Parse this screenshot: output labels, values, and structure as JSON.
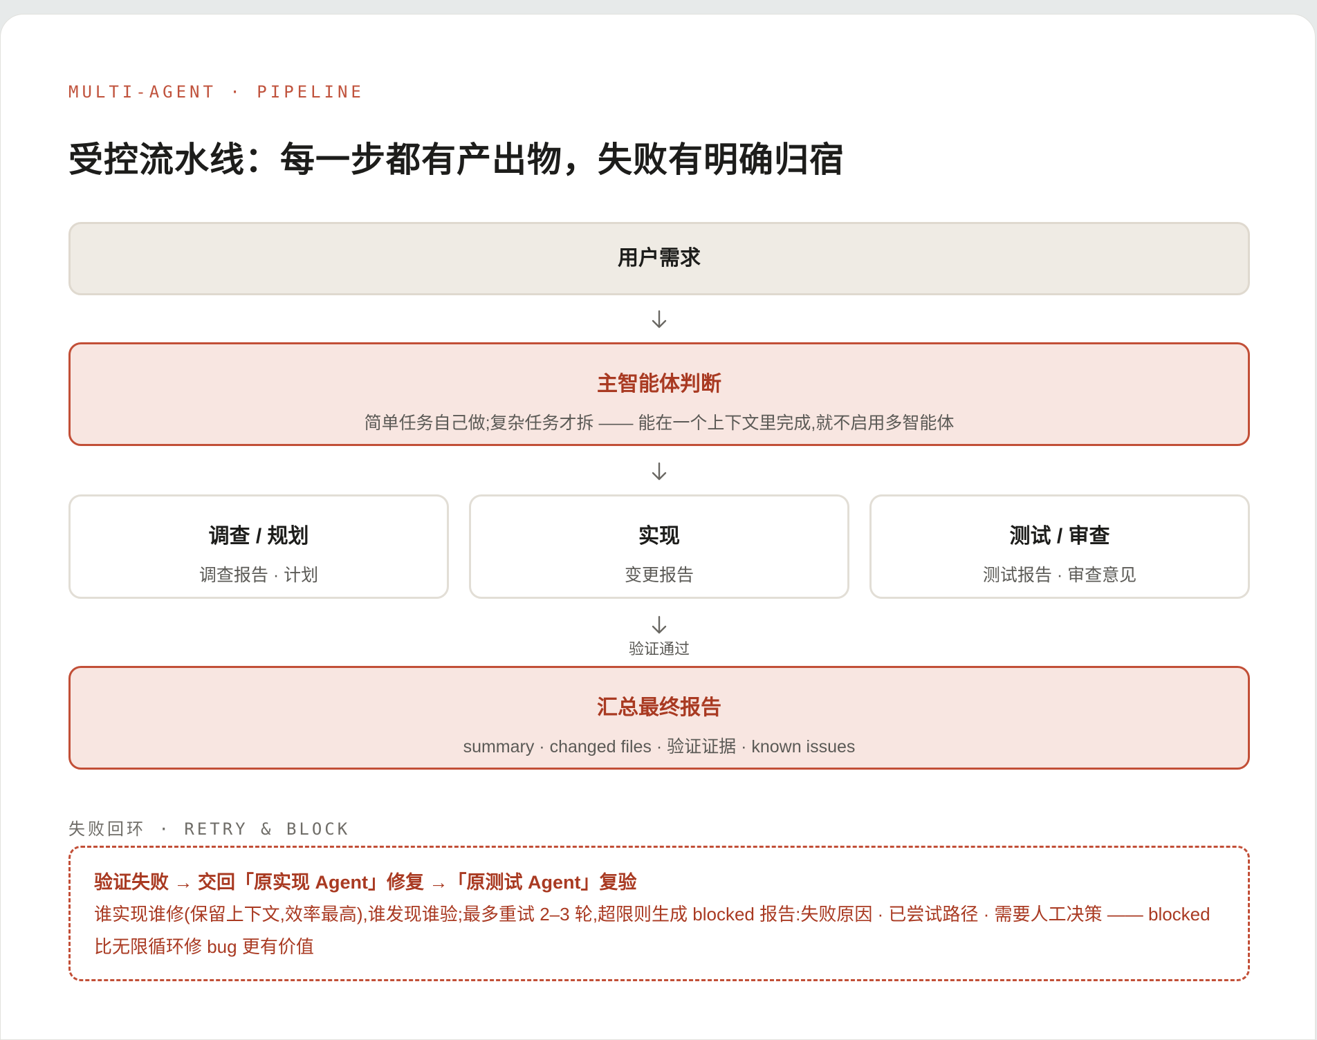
{
  "header": {
    "eyebrow": "MULTI-AGENT · PIPELINE",
    "title": "受控流水线：每一步都有产出物，失败有明确归宿"
  },
  "flow": {
    "input": {
      "title": "用户需求"
    },
    "decision": {
      "title": "主智能体判断",
      "subtitle": "简单任务自己做;复杂任务才拆 —— 能在一个上下文里完成,就不启用多智能体"
    },
    "steps": [
      {
        "title": "调查 / 规划",
        "output": "调查报告 · 计划"
      },
      {
        "title": "实现",
        "output": "变更报告"
      },
      {
        "title": "测试 / 审查",
        "output": "测试报告 · 审查意见"
      }
    ],
    "verify_label": "验证通过",
    "final": {
      "title": "汇总最终报告",
      "subtitle": "summary · changed files · 验证证据 · known issues"
    }
  },
  "failure": {
    "section_label": "失败回环 · RETRY & BLOCK",
    "title": "验证失败 → 交回「原实现 Agent」修复 →「原测试 Agent」复验",
    "body": "谁实现谁修(保留上下文,效率最高),谁发现谁验;最多重试 2–3 轮,超限则生成 blocked 报告:失败原因 · 已尝试路径 · 需要人工决策 —— blocked 比无限循环修 bug 更有价值"
  },
  "colors": {
    "accent": "#c24f37",
    "accent_text": "#a93a22",
    "accent_fill": "#f8e6e1",
    "neutral_fill": "#efebe4",
    "text": "#1d1d1b",
    "muted": "#5b5a56"
  }
}
